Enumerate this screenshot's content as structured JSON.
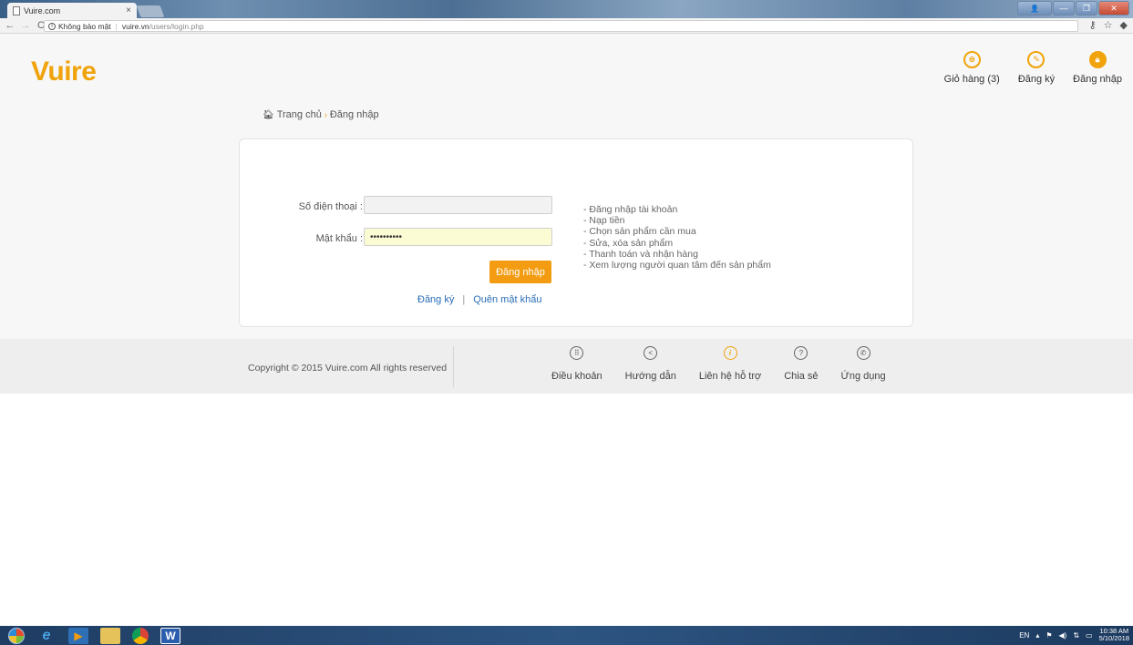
{
  "browser": {
    "tab_title": "Vuire.com",
    "tab_close": "×",
    "security_label": "Không bảo mật",
    "url_domain": "vuire.vn",
    "url_path": "/users/login.php"
  },
  "site": {
    "logo": "Vuire",
    "header_nav": [
      {
        "label": "Giỏ hàng (3)",
        "icon": "cart-icon"
      },
      {
        "label": "Đăng ký",
        "icon": "pen-icon"
      },
      {
        "label": "Đăng nhập",
        "icon": "lock-icon"
      }
    ],
    "breadcrumb": {
      "home": "Trang chủ",
      "current": "Đăng nhập"
    }
  },
  "login_form": {
    "phone_label": "Số điện thoại :",
    "phone_value": "",
    "password_label": "Mật khẩu :",
    "password_value": "••••••••••",
    "submit_label": "Đăng nhập",
    "register_link": "Đăng ký",
    "forgot_link": "Quên mật khẩu",
    "link_separator": "|"
  },
  "features": [
    "- Đăng nhập tài khoản",
    "- Nạp tiền",
    "- Chọn sản phẩm cần mua",
    "- Sửa, xóa sản phẩm",
    "- Thanh toán và nhận hàng",
    "- Xem lượng người quan tâm đến sản phẩm"
  ],
  "footer": {
    "copyright": "Copyright © 2015 Vuire.com All rights reserved",
    "nav": [
      {
        "label": "Điều khoản",
        "icon": "grid-icon"
      },
      {
        "label": "Hướng dẫn",
        "icon": "share-icon"
      },
      {
        "label": "Liên hệ hỗ trợ",
        "icon": "info-icon"
      },
      {
        "label": "Chia sẻ",
        "icon": "question-icon"
      },
      {
        "label": "Ứng dụng",
        "icon": "phone-icon"
      }
    ]
  },
  "taskbar": {
    "lang": "EN",
    "time": "10:38 AM",
    "date": "5/10/2018"
  },
  "colors": {
    "accent": "#f0a30a",
    "button": "#f39c12",
    "link": "#2a6db5"
  }
}
